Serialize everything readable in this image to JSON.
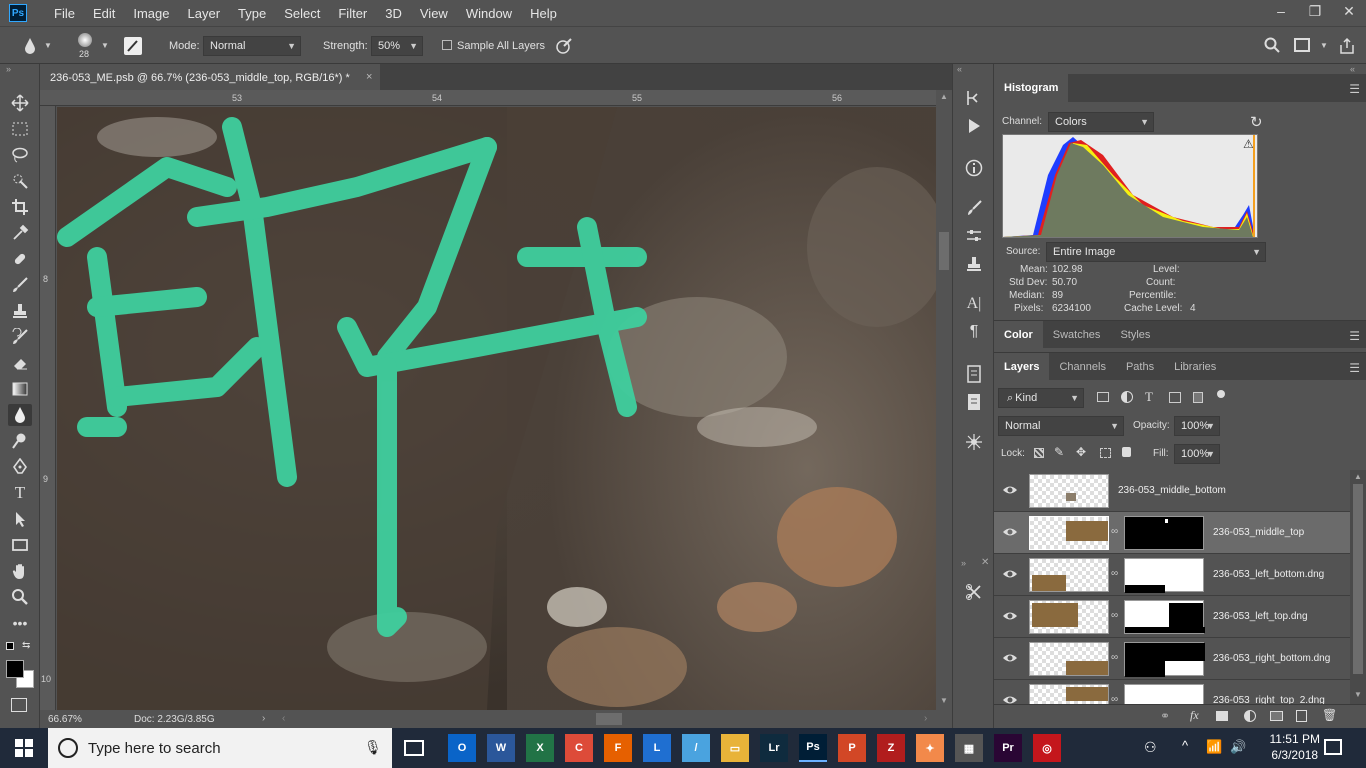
{
  "app": {
    "logo": "Ps"
  },
  "menu": [
    "File",
    "Edit",
    "Image",
    "Layer",
    "Type",
    "Select",
    "Filter",
    "3D",
    "View",
    "Window",
    "Help"
  ],
  "window_controls": {
    "minimize": "–",
    "restore": "❐",
    "close": "✕"
  },
  "options": {
    "brush_size": "28",
    "mode_label": "Mode:",
    "mode_value": "Normal",
    "strength_label": "Strength:",
    "strength_value": "50%",
    "sample_all_layers": "Sample All Layers"
  },
  "document": {
    "tab_title": "236-053_ME.psb @ 66.7% (236-053_middle_top, RGB/16*) *",
    "close": "×",
    "zoom": "66.67%",
    "doc_size": "Doc: 2.23G/3.85G",
    "ruler_top": [
      "53",
      "54",
      "55",
      "56"
    ],
    "ruler_left": [
      "8",
      "9",
      "10"
    ]
  },
  "histogram": {
    "tab": "Histogram",
    "channel_label": "Channel:",
    "channel_value": "Colors",
    "source_label": "Source:",
    "source_value": "Entire Image",
    "stats": [
      {
        "label": "Mean:",
        "value": "102.98"
      },
      {
        "label": "Std Dev:",
        "value": "50.70"
      },
      {
        "label": "Median:",
        "value": "89"
      },
      {
        "label": "Pixels:",
        "value": "6234100"
      }
    ],
    "stats_right": [
      {
        "label": "Level:",
        "value": ""
      },
      {
        "label": "Count:",
        "value": ""
      },
      {
        "label": "Percentile:",
        "value": ""
      },
      {
        "label": "Cache Level:",
        "value": "4"
      }
    ]
  },
  "color_panel": {
    "tabs": [
      "Color",
      "Swatches",
      "Styles"
    ]
  },
  "layers_panel": {
    "tabs": [
      "Layers",
      "Channels",
      "Paths",
      "Libraries"
    ],
    "filter_kind": "Kind",
    "blend_mode": "Normal",
    "opacity_label": "Opacity:",
    "opacity_value": "100%",
    "lock_label": "Lock:",
    "fill_label": "Fill:",
    "fill_value": "100%",
    "layers": [
      {
        "name": "236-053_middle_bottom",
        "has_mask": false,
        "selected": false
      },
      {
        "name": "236-053_middle_top",
        "has_mask": true,
        "selected": true
      },
      {
        "name": "236-053_left_bottom.dng",
        "has_mask": true,
        "selected": false
      },
      {
        "name": "236-053_left_top.dng",
        "has_mask": true,
        "selected": false
      },
      {
        "name": "236-053_right_bottom.dng",
        "has_mask": true,
        "selected": false
      },
      {
        "name": "236-053_right_top_2.dng",
        "has_mask": true,
        "selected": false
      }
    ]
  },
  "taskbar": {
    "search_placeholder": "Type here to search",
    "apps": [
      {
        "label": "O",
        "color": "#0a64c8"
      },
      {
        "label": "W",
        "color": "#2b579a"
      },
      {
        "label": "X",
        "color": "#217346"
      },
      {
        "label": "C",
        "color": "#dd4b39"
      },
      {
        "label": "F",
        "color": "#e66000"
      },
      {
        "label": "L",
        "color": "#1f6fd1"
      },
      {
        "label": "/",
        "color": "#4aa3df"
      },
      {
        "label": "▭",
        "color": "#e8b339"
      },
      {
        "label": "Lr",
        "color": "#0f2b3e"
      },
      {
        "label": "Ps",
        "color": "#001e36"
      },
      {
        "label": "P",
        "color": "#d24726"
      },
      {
        "label": "Z",
        "color": "#b11d1d"
      },
      {
        "label": "✦",
        "color": "#f2894a"
      },
      {
        "label": "▦",
        "color": "#555555"
      },
      {
        "label": "Pr",
        "color": "#2a0634"
      },
      {
        "label": "◎",
        "color": "#c4161c"
      }
    ],
    "time": "11:51 PM",
    "date": "6/3/2018"
  }
}
